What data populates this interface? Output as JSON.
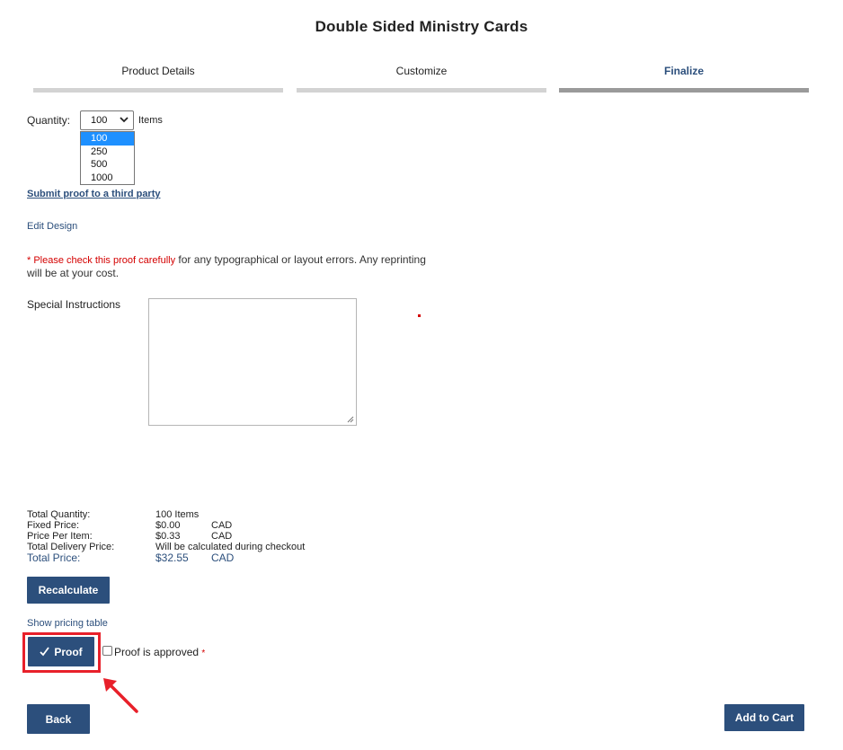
{
  "page": {
    "title": "Double Sided Ministry Cards"
  },
  "steps": [
    {
      "label": "Product Details",
      "active": false
    },
    {
      "label": "Customize",
      "active": false
    },
    {
      "label": "Finalize",
      "active": true
    }
  ],
  "quantity": {
    "label": "Quantity:",
    "selected": "100",
    "unit": "Items",
    "options": [
      "100",
      "250",
      "500",
      "1000"
    ]
  },
  "links": {
    "submit_proof": "Submit proof to a third party",
    "edit_design": "Edit Design",
    "show_pricing": "Show pricing table"
  },
  "warning": {
    "red": "* Please check this proof carefully",
    "rest": " for any typographical or layout errors. Any reprinting will be at your cost."
  },
  "special_instructions": {
    "label": "Special Instructions",
    "value": ""
  },
  "summary": {
    "total_quantity": {
      "label": "Total Quantity:",
      "value": "100 Items"
    },
    "fixed_price": {
      "label": "Fixed Price:",
      "value": "$0.00",
      "currency": "CAD"
    },
    "price_per_item": {
      "label": "Price Per Item:",
      "value": "$0.33",
      "currency": "CAD"
    },
    "total_delivery": {
      "label": "Total Delivery Price:",
      "value": "Will be calculated during checkout"
    },
    "total_price": {
      "label": "Total Price:",
      "value": "$32.55",
      "currency": "CAD"
    }
  },
  "buttons": {
    "recalculate": "Recalculate",
    "proof": "Proof",
    "back": "Back",
    "add_to_cart": "Add to Cart"
  },
  "proof_approval": {
    "label": "Proof is approved",
    "required_mark": "*",
    "checked": false
  },
  "colors": {
    "primary": "#2c4f7c",
    "required": "#d40000",
    "highlight": "#e8202a",
    "selected_option": "#1e90ff"
  },
  "icons": {
    "proof_check": "checkmark-icon",
    "annotation": "red-arrow-icon"
  }
}
